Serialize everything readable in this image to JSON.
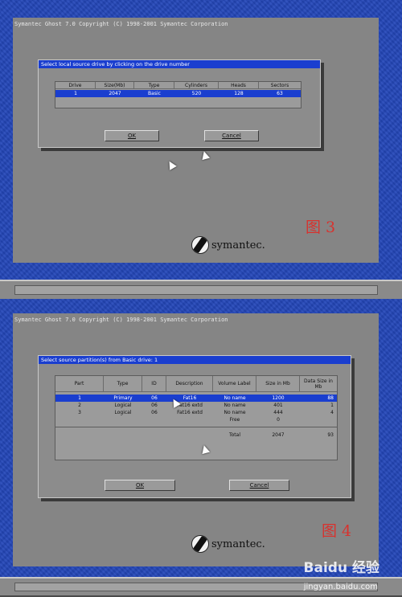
{
  "top": {
    "window_title": "Symantec Ghost 7.0   Copyright (C) 1998-2001 Symantec Corporation",
    "dialog": {
      "title": "Select local source drive by clicking on the drive number",
      "columns": [
        "Drive",
        "Size(Mb)",
        "Type",
        "Cylinders",
        "Heads",
        "Sectors"
      ],
      "rows": [
        [
          "1",
          "2047",
          "Basic",
          "520",
          "128",
          "63"
        ]
      ],
      "ok": "OK",
      "cancel": "Cancel"
    },
    "figure_label": "图 3",
    "logo_text": "symantec."
  },
  "bottom": {
    "window_title": "Symantec Ghost 7.0   Copyright (C) 1998-2001 Symantec Corporation",
    "dialog": {
      "title": "Select source partition(s) from Basic drive: 1",
      "columns": [
        "Part",
        "Type",
        "ID",
        "Description",
        "Volume Label",
        "Size in Mb",
        "Data Size in Mb"
      ],
      "rows": [
        [
          "1",
          "Primary",
          "06",
          "Fat16",
          "No name",
          "1200",
          "88"
        ],
        [
          "2",
          "Logical",
          "06",
          "Fat16 extd",
          "No name",
          "401",
          "1"
        ],
        [
          "3",
          "Logical",
          "06",
          "Fat16 extd",
          "No name",
          "444",
          "4"
        ],
        [
          "",
          "",
          "",
          "",
          "Free",
          "0",
          ""
        ]
      ],
      "total_label": "Total",
      "total_size": "2047",
      "total_data": "93",
      "ok": "OK",
      "cancel": "Cancel"
    },
    "figure_label": "图 4",
    "logo_text": "symantec."
  },
  "watermark": {
    "brand": "Baidu 经验",
    "url": "jingyan.baidu.com"
  },
  "colors": {
    "desktop_blue": "#2346b8",
    "panel_gray": "#858585",
    "title_blue": "#1a3ecf",
    "figure_red": "#d8322e"
  }
}
